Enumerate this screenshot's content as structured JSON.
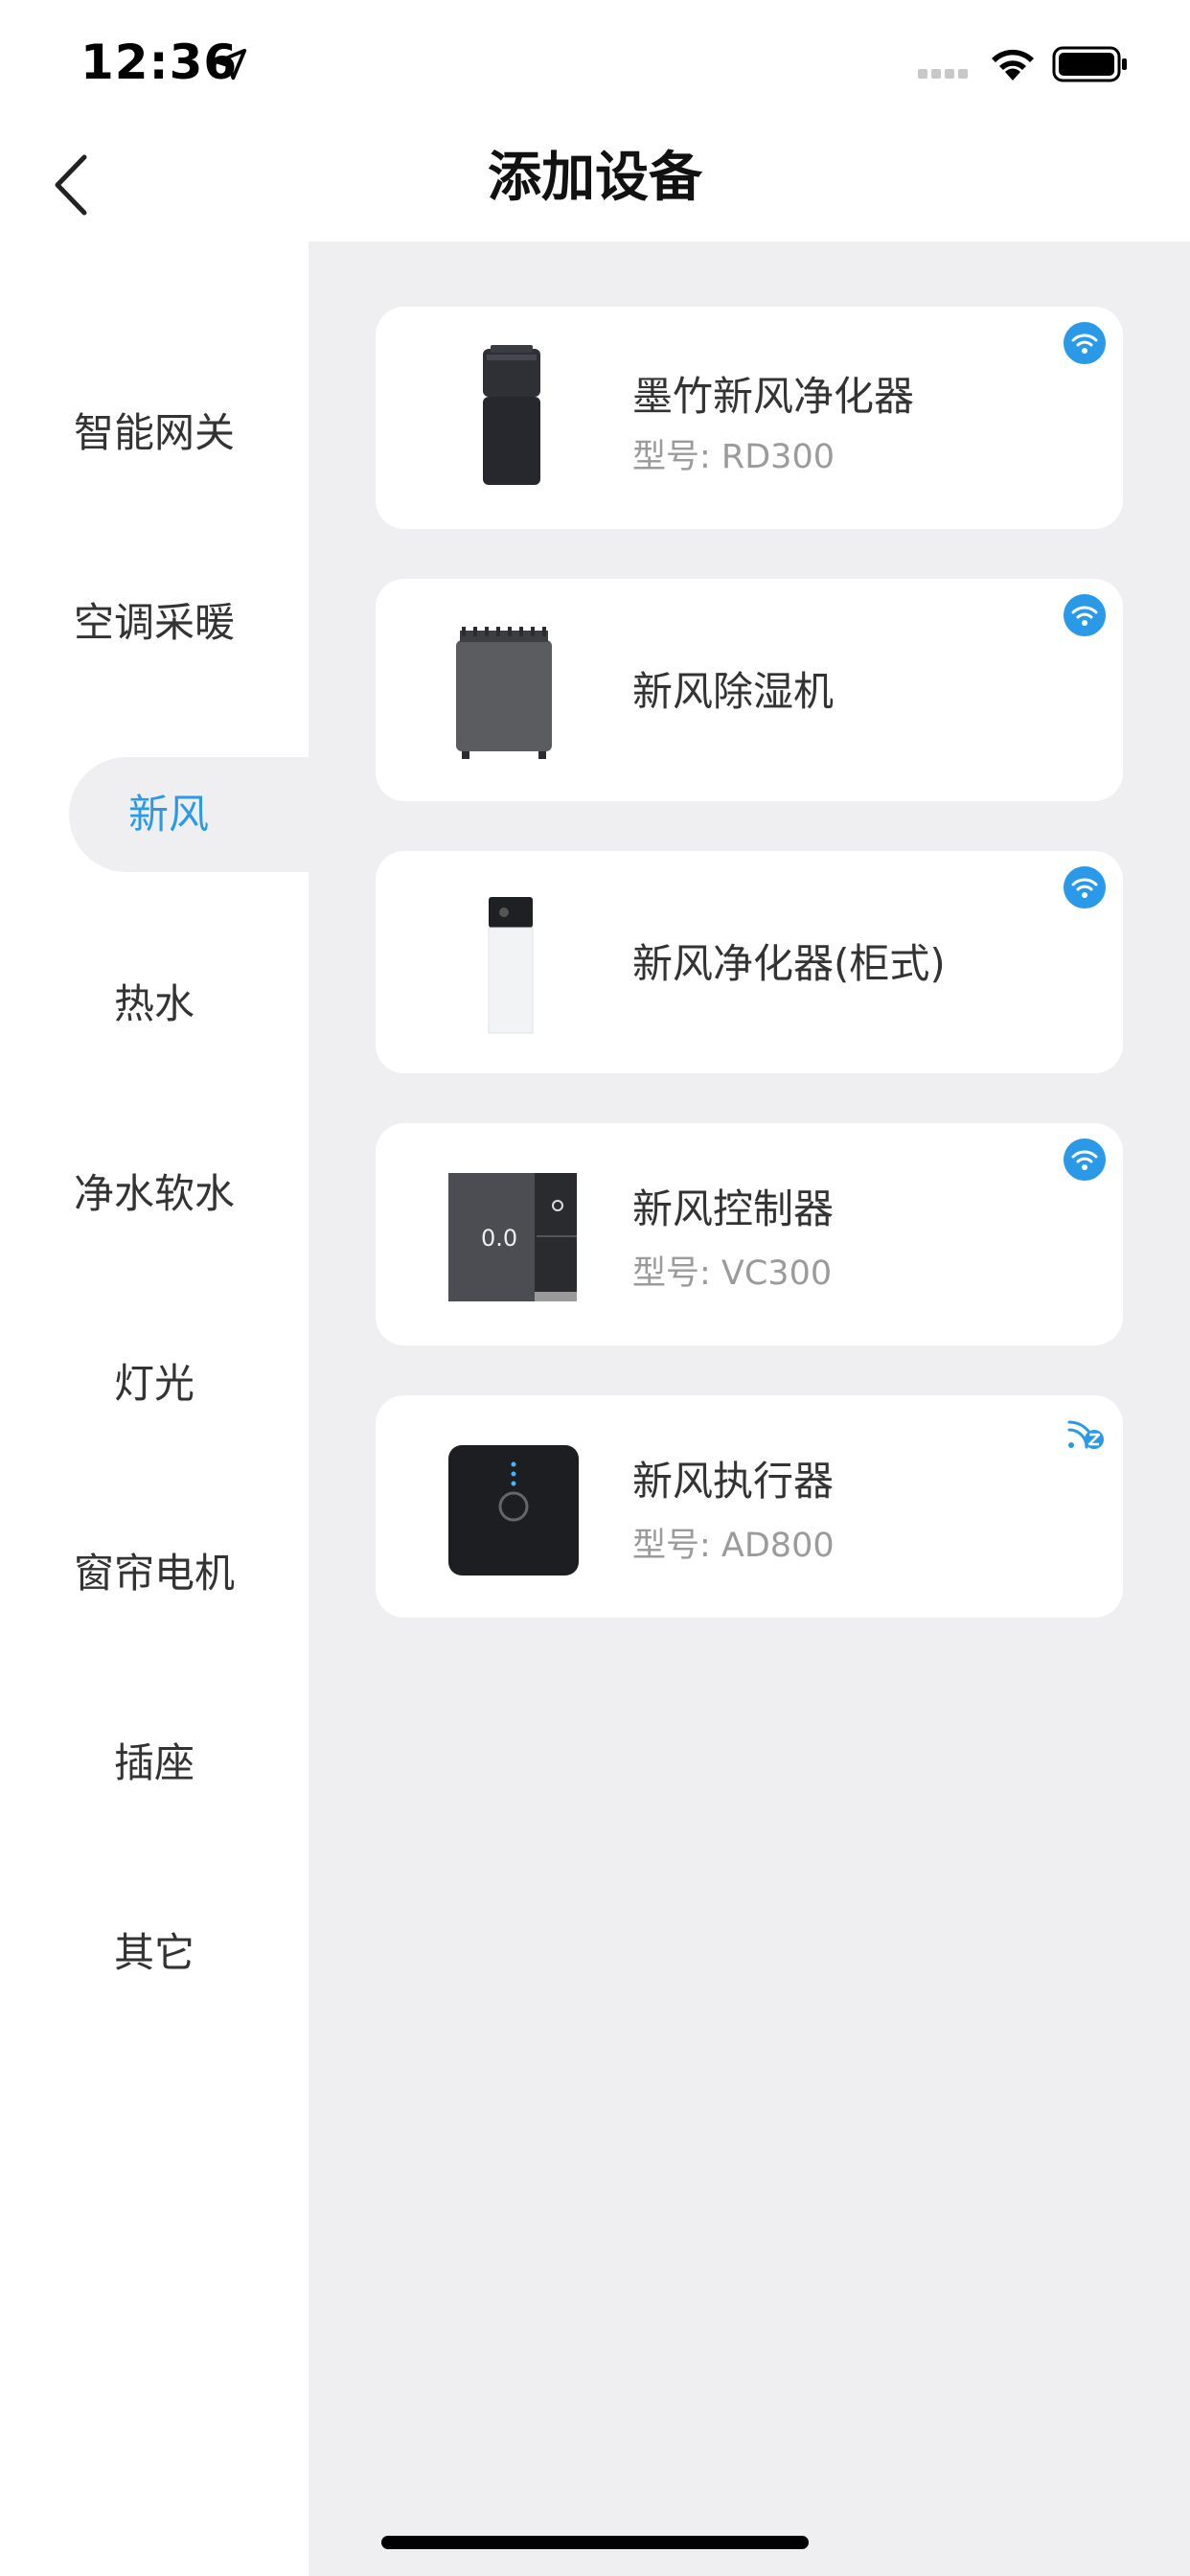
{
  "status_bar": {
    "time": "12:36"
  },
  "nav": {
    "title": "添加设备"
  },
  "sidebar": {
    "items": [
      {
        "label": "智能网关"
      },
      {
        "label": "空调采暖"
      },
      {
        "label": "新风",
        "active": true
      },
      {
        "label": "热水"
      },
      {
        "label": "净水软水"
      },
      {
        "label": "灯光"
      },
      {
        "label": "窗帘电机"
      },
      {
        "label": "插座"
      },
      {
        "label": "其它"
      }
    ]
  },
  "devices": [
    {
      "name": "墨竹新风净化器",
      "model": "型号:  RD300",
      "connectivity": "wifi-icon"
    },
    {
      "name": "新风除湿机",
      "model": "",
      "connectivity": "wifi-icon"
    },
    {
      "name": "新风净化器(柜式)",
      "model": "",
      "connectivity": "wifi-icon"
    },
    {
      "name": "新风控制器",
      "model": "型号:  VC300",
      "connectivity": "wifi-icon"
    },
    {
      "name": "新风执行器",
      "model": "型号:  AD800",
      "connectivity": "zigbee-icon"
    }
  ],
  "colors": {
    "accent": "#2a9ae8",
    "background": "#efeff1"
  }
}
